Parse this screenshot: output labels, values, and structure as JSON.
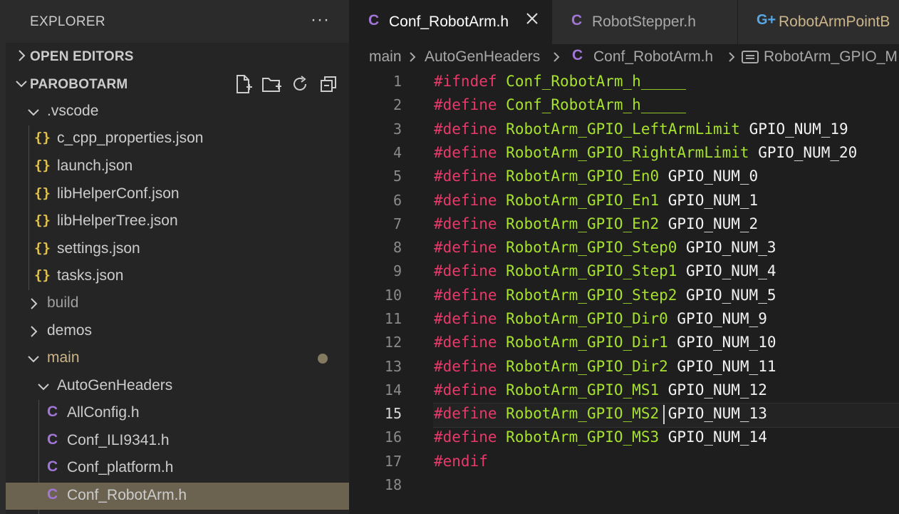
{
  "sidebar": {
    "title": "EXPLORER",
    "more": "···",
    "open_editors": "OPEN EDITORS",
    "project": "PAROBOTARM",
    "tree": [
      {
        "label": ".vscode",
        "kind": "folder-open"
      },
      {
        "label": "c_cpp_properties.json",
        "kind": "json"
      },
      {
        "label": "launch.json",
        "kind": "json"
      },
      {
        "label": "libHelperConf.json",
        "kind": "json"
      },
      {
        "label": "libHelperTree.json",
        "kind": "json"
      },
      {
        "label": "settings.json",
        "kind": "json"
      },
      {
        "label": "tasks.json",
        "kind": "json"
      },
      {
        "label": "build",
        "kind": "folder-closed"
      },
      {
        "label": "demos",
        "kind": "folder-closed"
      },
      {
        "label": "main",
        "kind": "folder-open"
      },
      {
        "label": "AutoGenHeaders",
        "kind": "folder-open"
      },
      {
        "label": "AllConfig.h",
        "kind": "c"
      },
      {
        "label": "Conf_ILI9341.h",
        "kind": "c"
      },
      {
        "label": "Conf_platform.h",
        "kind": "c"
      },
      {
        "label": "Conf_RobotArm.h",
        "kind": "c"
      }
    ],
    "json_icon": "{}",
    "c_icon": "C"
  },
  "tabs": [
    {
      "label": "Conf_RobotArm.h",
      "icon": "C",
      "active": true
    },
    {
      "label": "RobotStepper.h",
      "icon": "C",
      "active": false
    },
    {
      "label": "RobotArmPointB",
      "icon": "G+",
      "active": false
    }
  ],
  "breadcrumb": {
    "folder1": "main",
    "folder2": "AutoGenHeaders",
    "file": "Conf_RobotArm.h",
    "symbol": "RobotArm_GPIO_M"
  },
  "editor": {
    "current_line": 15,
    "lines": [
      {
        "n": "1",
        "kw": "#ifndef",
        "macro": "Conf_RobotArm_h_____",
        "value": ""
      },
      {
        "n": "2",
        "kw": "#define",
        "macro": "Conf_RobotArm_h_____",
        "value": ""
      },
      {
        "n": "3",
        "kw": "#define",
        "macro": "RobotArm_GPIO_LeftArmLimit",
        "value": "GPIO_NUM_19"
      },
      {
        "n": "4",
        "kw": "#define",
        "macro": "RobotArm_GPIO_RightArmLimit",
        "value": "GPIO_NUM_20"
      },
      {
        "n": "5",
        "kw": "#define",
        "macro": "RobotArm_GPIO_En0",
        "value": "GPIO_NUM_0"
      },
      {
        "n": "6",
        "kw": "#define",
        "macro": "RobotArm_GPIO_En1",
        "value": "GPIO_NUM_1"
      },
      {
        "n": "7",
        "kw": "#define",
        "macro": "RobotArm_GPIO_En2",
        "value": "GPIO_NUM_2"
      },
      {
        "n": "8",
        "kw": "#define",
        "macro": "RobotArm_GPIO_Step0",
        "value": "GPIO_NUM_3"
      },
      {
        "n": "9",
        "kw": "#define",
        "macro": "RobotArm_GPIO_Step1",
        "value": "GPIO_NUM_4"
      },
      {
        "n": "10",
        "kw": "#define",
        "macro": "RobotArm_GPIO_Step2",
        "value": "GPIO_NUM_5"
      },
      {
        "n": "11",
        "kw": "#define",
        "macro": "RobotArm_GPIO_Dir0",
        "value": "GPIO_NUM_9"
      },
      {
        "n": "12",
        "kw": "#define",
        "macro": "RobotArm_GPIO_Dir1",
        "value": "GPIO_NUM_10"
      },
      {
        "n": "13",
        "kw": "#define",
        "macro": "RobotArm_GPIO_Dir2",
        "value": "GPIO_NUM_11"
      },
      {
        "n": "14",
        "kw": "#define",
        "macro": "RobotArm_GPIO_MS1",
        "value": "GPIO_NUM_12"
      },
      {
        "n": "15",
        "kw": "#define",
        "macro": "RobotArm_GPIO_MS2",
        "value": "GPIO_NUM_13"
      },
      {
        "n": "16",
        "kw": "#define",
        "macro": "RobotArm_GPIO_MS3",
        "value": "GPIO_NUM_14"
      },
      {
        "n": "17",
        "kw": "#endif",
        "macro": "",
        "value": ""
      },
      {
        "n": "18",
        "kw": "",
        "macro": "",
        "value": ""
      }
    ]
  },
  "colors": {
    "keyword": "#e8396a",
    "macro": "#a6e22e",
    "value": "#f2f2f2",
    "json_icon": "#e2c24a",
    "c_icon": "#a176d6",
    "selection": "#6b6350"
  },
  "icons": [
    "chevron-right-icon",
    "chevron-down-icon",
    "new-file-icon",
    "new-folder-icon",
    "refresh-icon",
    "collapse-all-icon",
    "close-icon",
    "symbol-constant-icon",
    "modified-dot-icon"
  ]
}
